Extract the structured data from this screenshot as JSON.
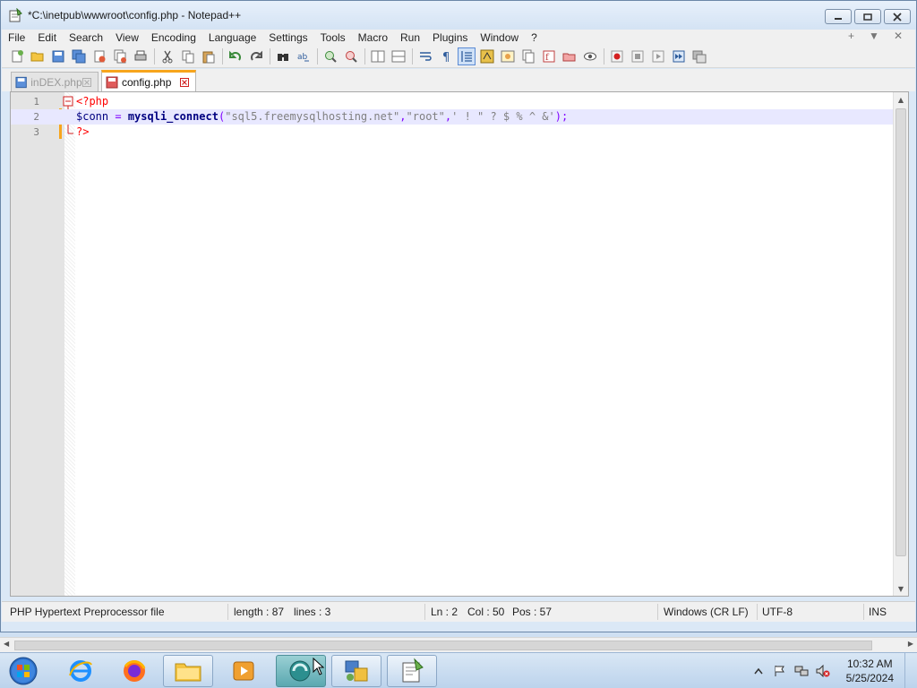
{
  "window": {
    "title": "*C:\\inetpub\\wwwroot\\config.php - Notepad++"
  },
  "menu": [
    "File",
    "Edit",
    "Search",
    "View",
    "Encoding",
    "Language",
    "Settings",
    "Tools",
    "Macro",
    "Run",
    "Plugins",
    "Window",
    "?"
  ],
  "menu_right": [
    "+",
    "▼",
    "✕"
  ],
  "tabs": [
    {
      "label": "inDEX.php",
      "state": "inactive"
    },
    {
      "label": "config.php",
      "state": "active"
    }
  ],
  "editor": {
    "lines": [
      {
        "number": "1",
        "code": "<?php"
      },
      {
        "number": "2",
        "code": "$conn = mysqli_connect(\"sql5.freemysqlhosting.net\",\"root\",' ! \" ? $ % ^ &');"
      },
      {
        "number": "3",
        "code": "?>"
      }
    ],
    "current_line": 2
  },
  "statusbar": {
    "filetype": "PHP Hypertext Preprocessor file",
    "length": "length : 87",
    "lines": "lines : 3",
    "ln": "Ln : 2",
    "col": "Col : 50",
    "pos": "Pos : 57",
    "eol": "Windows (CR LF)",
    "encoding": "UTF-8",
    "mode": "INS"
  },
  "taskbar": {
    "clock_time": "10:32 AM",
    "clock_date": "5/25/2024"
  },
  "colors": {
    "tab_accent": "#f7a51c",
    "php_tag": "#ff0000",
    "function": "#000080",
    "string": "#808080",
    "current_line_bg": "#e8e8ff"
  }
}
